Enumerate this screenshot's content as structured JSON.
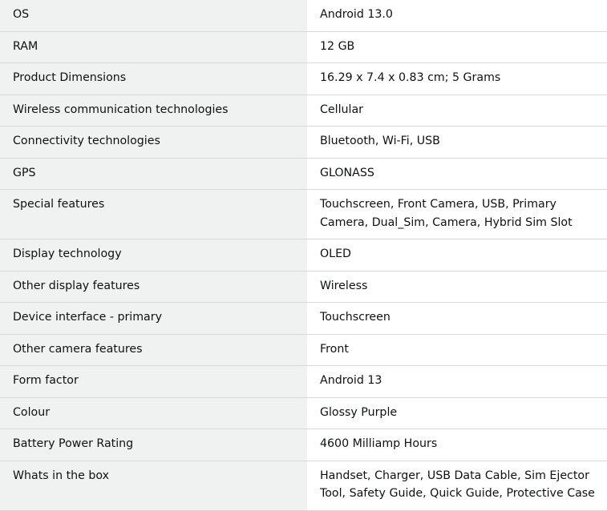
{
  "specifications": [
    {
      "label": "OS",
      "value": "Android 13.0"
    },
    {
      "label": "RAM",
      "value": "12 GB"
    },
    {
      "label": "Product Dimensions",
      "value": "16.29 x 7.4 x 0.83 cm; 5 Grams"
    },
    {
      "label": "Wireless communication technologies",
      "value": "Cellular"
    },
    {
      "label": "Connectivity technologies",
      "value": "Bluetooth, Wi-Fi, USB"
    },
    {
      "label": "GPS",
      "value": "GLONASS"
    },
    {
      "label": "Special features",
      "value": "Touchscreen, Front Camera, USB, Primary Camera, Dual_Sim, Camera, Hybrid Sim Slot"
    },
    {
      "label": "Display technology",
      "value": "OLED"
    },
    {
      "label": "Other display features",
      "value": "Wireless"
    },
    {
      "label": "Device interface - primary",
      "value": "Touchscreen"
    },
    {
      "label": "Other camera features",
      "value": "Front"
    },
    {
      "label": "Form factor",
      "value": "Android 13"
    },
    {
      "label": "Colour",
      "value": "Glossy Purple"
    },
    {
      "label": "Battery Power Rating",
      "value": "4600 Milliamp Hours"
    },
    {
      "label": "Whats in the box",
      "value": "Handset, Charger, USB Data Cable, Sim Ejector Tool, Safety Guide, Quick Guide, Protective Case"
    }
  ]
}
